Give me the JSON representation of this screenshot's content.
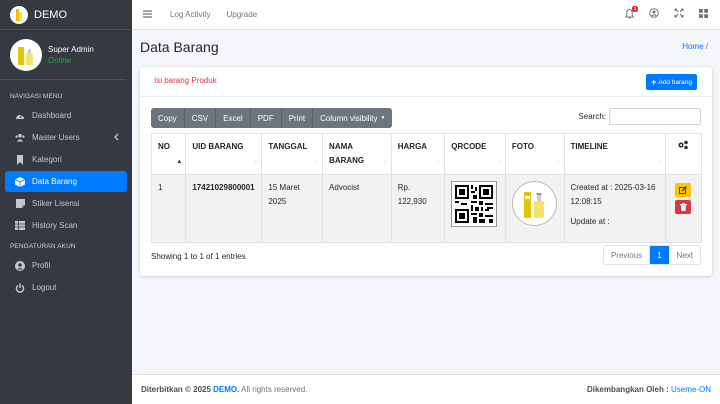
{
  "brand": {
    "name": "DEMO"
  },
  "user": {
    "name": "Super Admin",
    "status": "Online"
  },
  "sidebar": {
    "header_nav": "NAVIGASI MENU",
    "header_account": "PENGATURAN AKUN",
    "items": [
      {
        "label": "Dashboard",
        "icon": "dashboard-icon"
      },
      {
        "label": "Master Users",
        "icon": "users-icon"
      },
      {
        "label": "Kategori",
        "icon": "bookmark-icon"
      },
      {
        "label": "Data Barang",
        "icon": "box-icon",
        "active": true
      },
      {
        "label": "Stiker Lisensi",
        "icon": "sticker-icon"
      },
      {
        "label": "History Scan",
        "icon": "table-icon"
      }
    ],
    "account_items": [
      {
        "label": "Profil",
        "icon": "user-circle-icon"
      },
      {
        "label": "Logout",
        "icon": "power-icon"
      }
    ]
  },
  "topbar": {
    "links": [
      "Log Activity",
      "Upgrade"
    ],
    "notification_count": "1"
  },
  "page": {
    "title": "Data Barang",
    "breadcrumb": "Home",
    "breadcrumb_sep": "/"
  },
  "card": {
    "title": "Isi barang Produk",
    "add_button": "Add barang",
    "export_buttons": [
      "Copy",
      "CSV",
      "Excel",
      "PDF",
      "Print",
      "Column visibility"
    ],
    "search_label": "Search:",
    "search_value": ""
  },
  "table": {
    "columns": [
      "NO",
      "UID BARANG",
      "TANGGAL",
      "NAMA BARANG",
      "HARGA",
      "QRCODE",
      "FOTO",
      "TIMELINE"
    ],
    "rows": [
      {
        "no": "1",
        "uid": "17421029800001",
        "tanggal": "15 Maret 2025",
        "nama": "Advocist",
        "harga": "Rp. 122,930",
        "created": "Created at : 2025-03-16 12:08:15",
        "updated": "Update at :"
      }
    ]
  },
  "pagination": {
    "info": "Showing 1 to 1 of 1 entries",
    "previous": "Previous",
    "current": "1",
    "next": "Next"
  },
  "footer": {
    "left_prefix": "Diterbitkan © 2025",
    "left_brand": "DEMO.",
    "left_suffix": "All rights reserved.",
    "right_prefix": "Dikembangkan Oleh :",
    "right_link": "Useme-ON"
  },
  "colors": {
    "primary": "#007bff",
    "sidebar": "#343a40",
    "danger": "#dc3545",
    "warning": "#ffc107",
    "online": "#28a745"
  }
}
